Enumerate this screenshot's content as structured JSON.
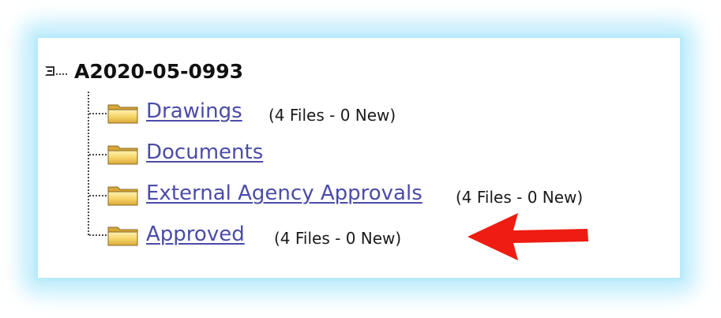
{
  "tree": {
    "root": {
      "label": "A2020-05-0993",
      "expander_icon": "tree-collapse-minus-icon"
    },
    "items": [
      {
        "label": "Drawings",
        "meta": "(4 Files - 0 New)",
        "icon": "folder-icon"
      },
      {
        "label": "Documents",
        "meta": "",
        "icon": "folder-icon"
      },
      {
        "label": "External Agency Approvals",
        "meta": "(4 Files - 0 New)",
        "icon": "folder-icon"
      },
      {
        "label": "Approved",
        "meta": "(4 Files - 0 New)",
        "icon": "folder-icon"
      }
    ]
  },
  "annotation": {
    "icon": "red-arrow-icon",
    "color": "#ee1c12"
  },
  "colors": {
    "link": "#4b4ca8",
    "glow": "#b3e9fb"
  }
}
